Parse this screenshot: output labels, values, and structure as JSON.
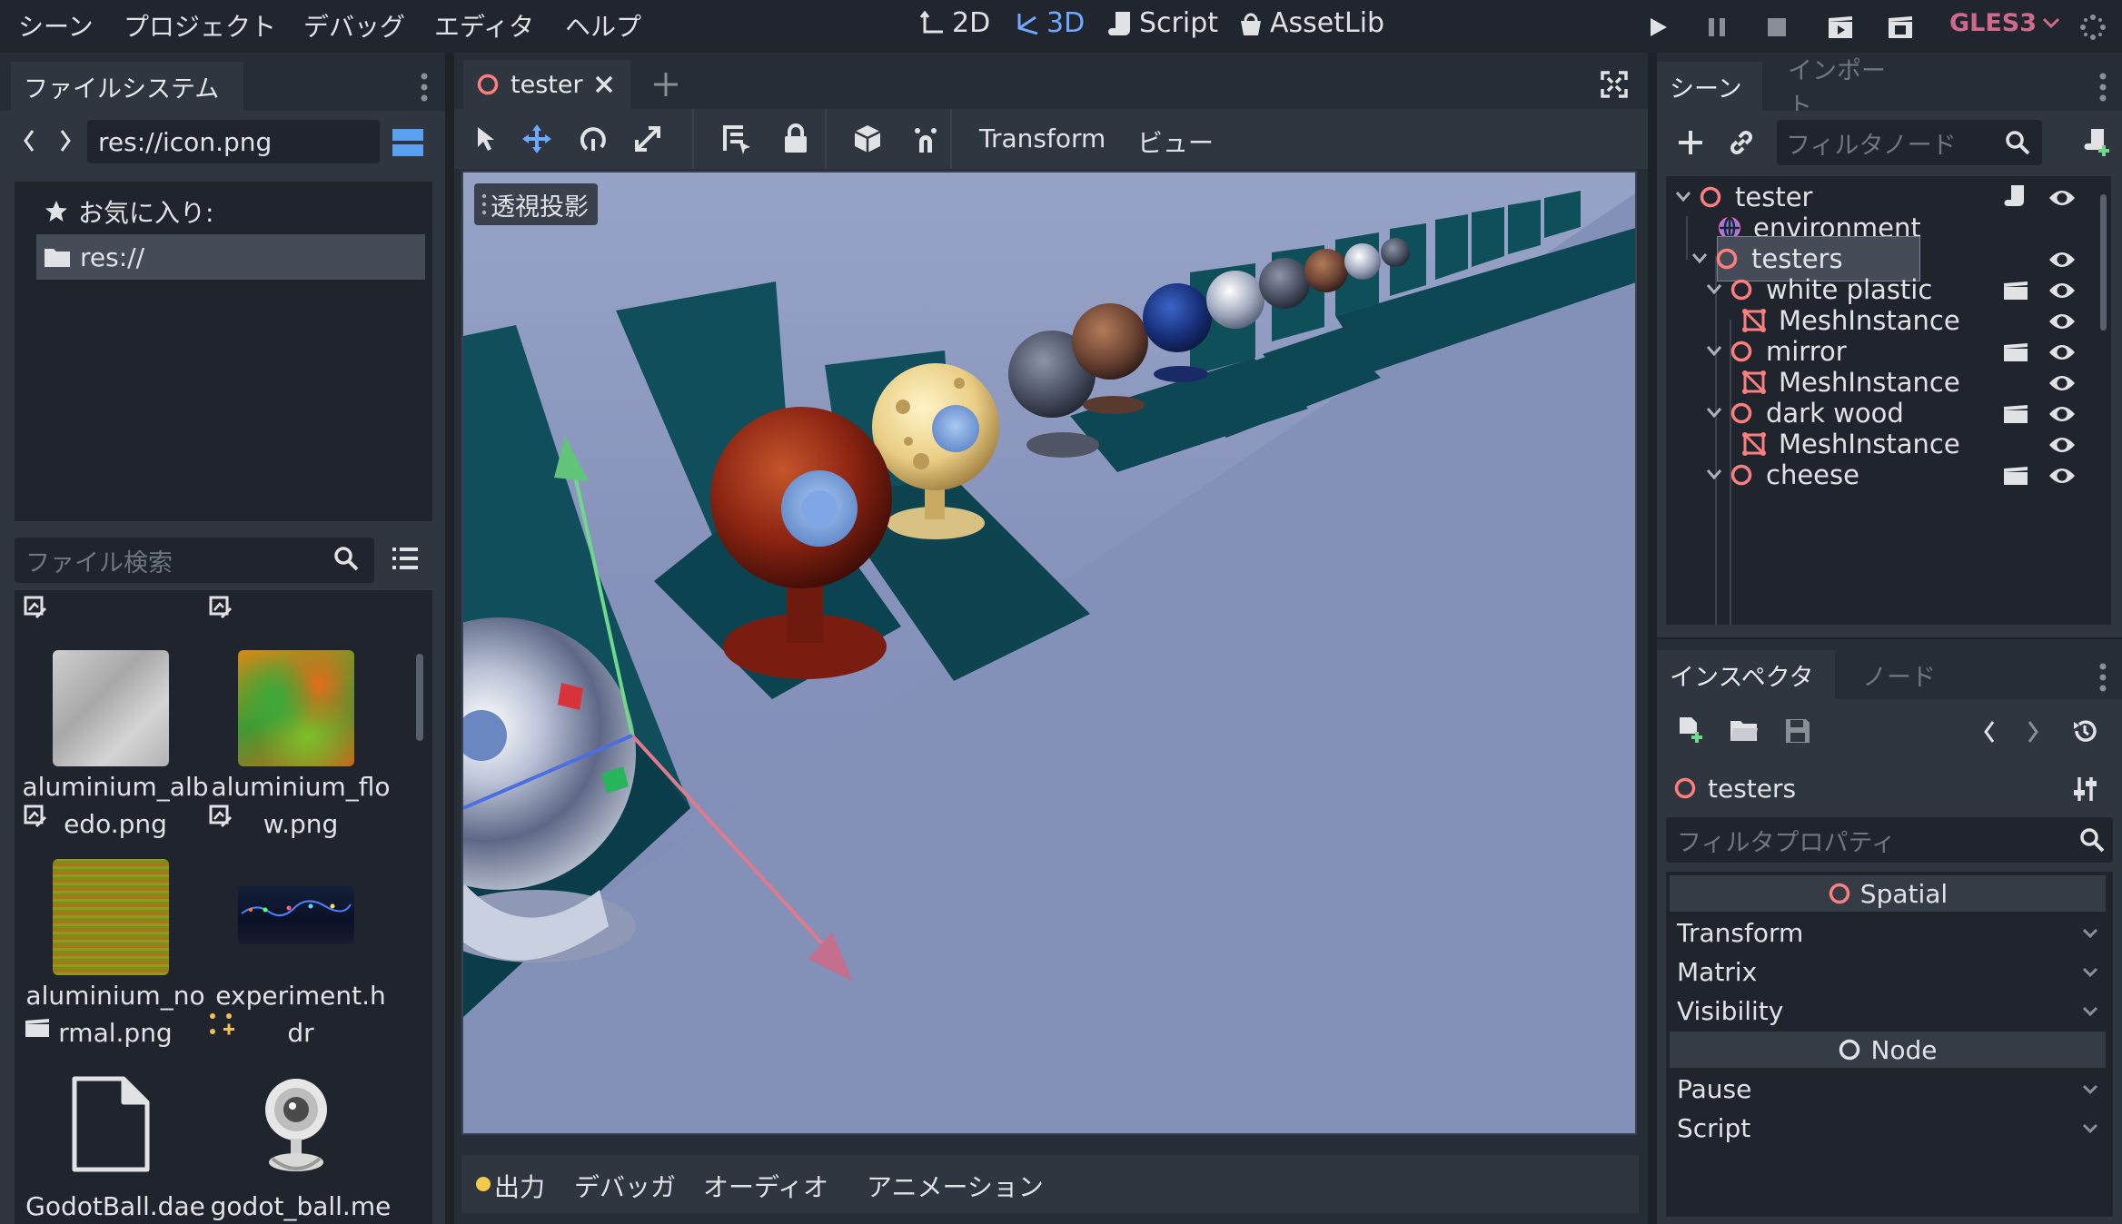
{
  "menu": [
    "シーン",
    "プロジェクト",
    "デバッグ",
    "エディタ",
    "ヘルプ"
  ],
  "workspaces": [
    {
      "label": "2D",
      "icon": "2d-icon"
    },
    {
      "label": "3D",
      "icon": "3d-icon"
    },
    {
      "label": "Script",
      "icon": "script-icon"
    },
    {
      "label": "AssetLib",
      "icon": "assetlib-icon"
    }
  ],
  "renderer": "GLES3",
  "filesystem": {
    "tab": "ファイルシステム",
    "path": "res://icon.png",
    "favorites_label": "お気に入り:",
    "root": "res://",
    "search_placeholder": "ファイル検索",
    "files": [
      {
        "name": "aluminium_albedo.png",
        "line1": "aluminium_alb",
        "line2": "edo.png"
      },
      {
        "name": "aluminium_flow.png",
        "line1": "aluminium_flo",
        "line2": "w.png"
      },
      {
        "name": "aluminium_normal.png",
        "line1": "aluminium_no",
        "line2": "rmal.png"
      },
      {
        "name": "experiment.hdr",
        "line1": "experiment.h",
        "line2": "dr"
      },
      {
        "name": "GodotBall.dae",
        "line1": "GodotBall.dae",
        "line2": ""
      },
      {
        "name": "godot_ball.mesh",
        "line1": "godot_ball.me",
        "line2": "sh"
      }
    ]
  },
  "editor": {
    "tab": "tester",
    "toolbar_transform": "Transform",
    "toolbar_view": "ビュー",
    "viewport_label": "透視投影"
  },
  "bottom_tabs": [
    "出力",
    "デバッガ",
    "オーディオ",
    "アニメーション"
  ],
  "scene": {
    "tabs": [
      "シーン",
      "インポート"
    ],
    "filter_placeholder": "フィルタノード",
    "nodes": [
      {
        "label": "tester",
        "type": "spatial",
        "depth": 0
      },
      {
        "label": "environment",
        "type": "environment",
        "depth": 1
      },
      {
        "label": "testers",
        "type": "spatial",
        "depth": 1
      },
      {
        "label": "white plastic",
        "type": "spatial",
        "depth": 2
      },
      {
        "label": "MeshInstance",
        "type": "mesh",
        "depth": 3
      },
      {
        "label": "mirror",
        "type": "spatial",
        "depth": 2
      },
      {
        "label": "MeshInstance",
        "type": "mesh",
        "depth": 3
      },
      {
        "label": "dark wood",
        "type": "spatial",
        "depth": 2
      },
      {
        "label": "MeshInstance",
        "type": "mesh",
        "depth": 3
      },
      {
        "label": "cheese",
        "type": "spatial",
        "depth": 2
      }
    ]
  },
  "inspector": {
    "tabs": [
      "インスペクタ",
      "ノード"
    ],
    "object": "testers",
    "filter_placeholder": "フィルタプロパティ",
    "section_spatial": "Spatial",
    "spatial_props": [
      "Transform",
      "Matrix",
      "Visibility"
    ],
    "section_node": "Node",
    "node_props": [
      "Pause",
      "Script"
    ]
  },
  "colors": {
    "accent": "#6fa8ff",
    "node_spatial": "#fc7f7f",
    "renderer": "#d06a8c",
    "teal": "#0e4a55"
  }
}
